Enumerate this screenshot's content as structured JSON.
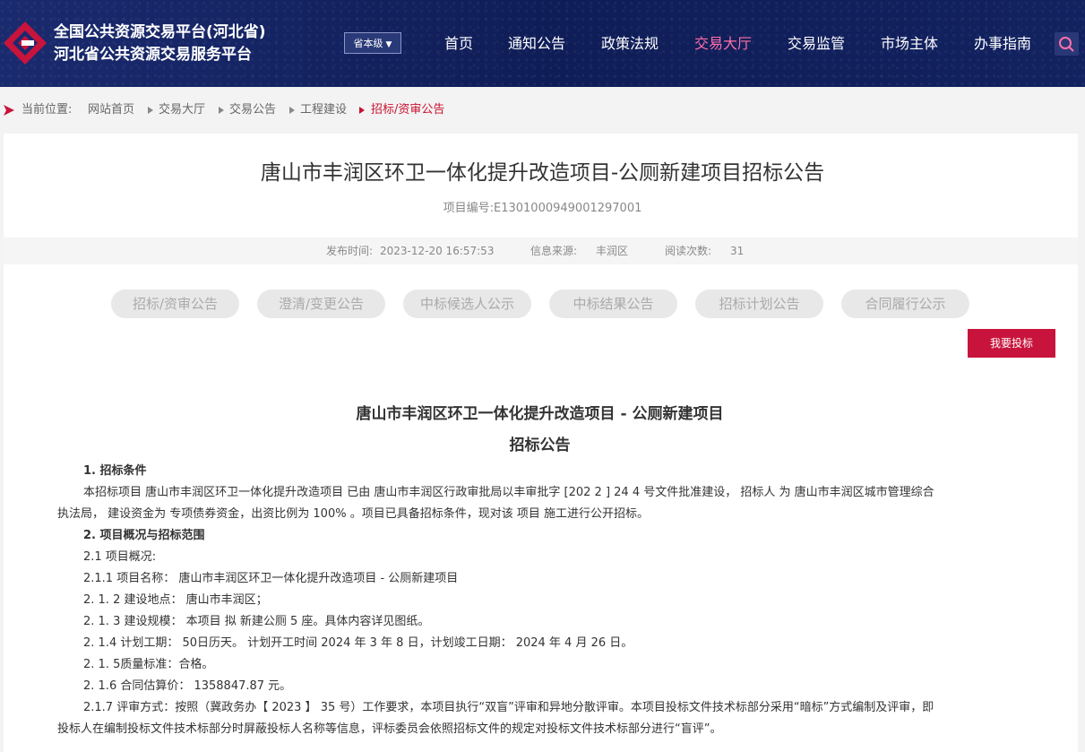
{
  "header": {
    "title_line1": "全国公共资源交易平台(河北省)",
    "title_line2": "河北省公共资源交易服务平台",
    "level_select": "省本级",
    "nav": [
      "首页",
      "通知公告",
      "政策法规",
      "交易大厅",
      "交易监管",
      "市场主体",
      "办事指南"
    ],
    "active_nav": "交易大厅",
    "accent_color": "#ff6fa8"
  },
  "breadcrumb": {
    "prefix": "当前位置:",
    "items": [
      "网站首页",
      "交易大厅",
      "交易公告",
      "工程建设"
    ],
    "current": "招标/资审公告"
  },
  "article": {
    "title": "唐山市丰润区环卫一体化提升改造项目-公厕新建项目招标公告",
    "project_code": "项目编号:E1301000949001297001",
    "publish_label": "发布时间:",
    "publish_time": "2023-12-20 16:57:53",
    "source_label": "信息来源:",
    "source": "丰润区",
    "reads_label": "阅读次数:",
    "reads": "31"
  },
  "tabs": [
    "招标/资审公告",
    "澄清/变更公告",
    "中标候选人公示",
    "中标结果公告",
    "招标计划公告",
    "合同履行公示"
  ],
  "bid_button": "我要投标",
  "doc": {
    "title1": "唐山市丰润区环卫一体化提升改造项目 - 公厕新建项目",
    "title2": "招标公告",
    "s1": "1. 招标条件",
    "p1a": "本招标项目 唐山市丰润区环卫一体化提升改造项目 已由 唐山市丰润区行政审批局以丰审批字 [202 2 ] 24 4 号文件批准建设， 招标人 为  唐山市丰润区城市管理综合",
    "p1b": "执法局， 建设资金为 专项债券资金，出资比例为 100% 。项目已具备招标条件，现对该 项目 施工进行公开招标。",
    "s2": "2. 项目概况与招标范围",
    "l1": "2.1 项目概况:",
    "l2": "2.1.1 项目名称： 唐山市丰润区环卫一体化提升改造项目 - 公厕新建项目",
    "l3": "2. 1. 2 建设地点： 唐山市丰润区；",
    "l4": "2. 1. 3 建设规模： 本项目 拟 新建公厕 5 座。具体内容详见图纸。",
    "l5": "2. 1.4 计划工期： 50日历天。  计划开工时间 2024 年 3 年 8 日，计划竣工日期： 2024 年 4 月 26 日。",
    "l6": "2. 1. 5质量标准：合格。",
    "l7": "2. 1.6 合同估算价： 1358847.87 元。",
    "l8a": "2.1.7 评审方式：按照（冀政务办【 2023 】 35 号）工作要求，本项目执行“双盲”评审和异地分散评审。本项目投标文件技术标部分采用“暗标”方式编制及评审，即",
    "l8b": "投标人在编制投标文件技术标部分时屏蔽投标人名称等信息，评标委员会依照招标文件的规定对投标文件技术标部分进行“盲评”。"
  }
}
